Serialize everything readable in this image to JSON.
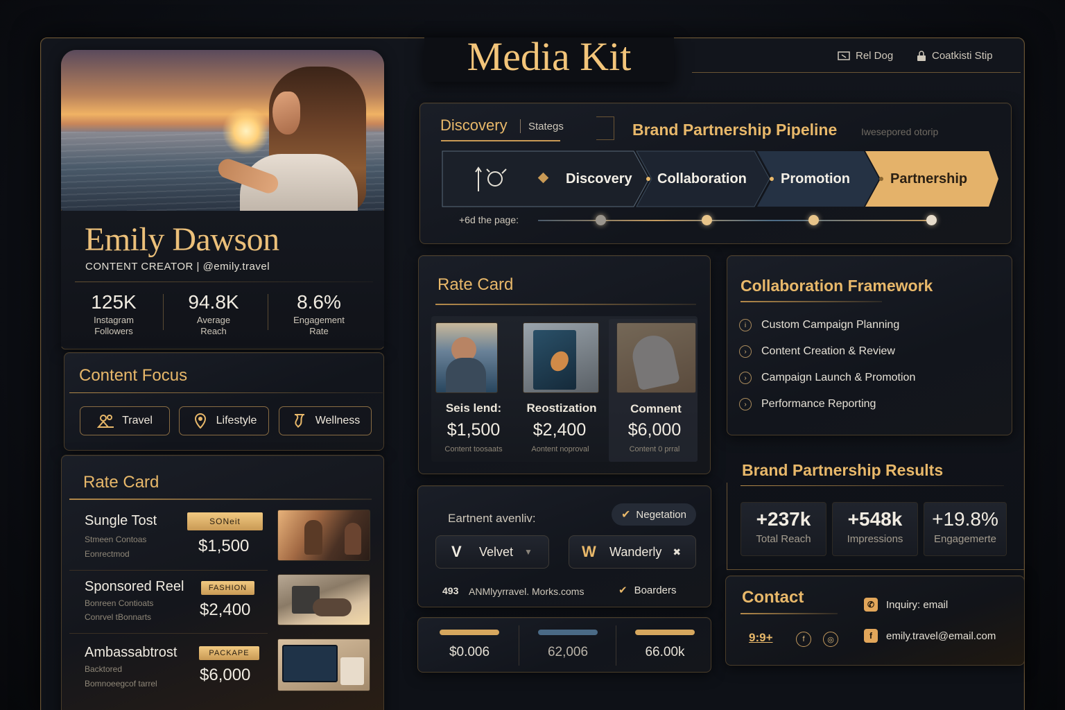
{
  "header": {
    "title": "Media Kit",
    "nav": [
      {
        "label": "Rel Dog",
        "icon": "display-icon"
      },
      {
        "label": "Coatkisti Stip",
        "icon": "lock-icon"
      }
    ]
  },
  "profile": {
    "name": "Emily Dawson",
    "subtitle": "CONTENT CREATOR | @emily.travel",
    "stats": [
      {
        "value": "125K",
        "label1": "Instagram",
        "label2": "Followers"
      },
      {
        "value": "94.8K",
        "label1": "Average",
        "label2": "Reach"
      },
      {
        "value": "8.6%",
        "label1": "Engagement",
        "label2": "Rate"
      }
    ]
  },
  "content_focus": {
    "title": "Content Focus",
    "tags": [
      {
        "label": "Travel",
        "icon": "people-icon"
      },
      {
        "label": "Lifestyle",
        "icon": "location-pin-icon"
      },
      {
        "label": "Wellness",
        "icon": "wellness-icon"
      }
    ]
  },
  "left_rate_card": {
    "title": "Rate Card",
    "rows": [
      {
        "title": "Sungle Tost",
        "sub1": "Stmeen Contoas",
        "sub2": "Eonrectmod",
        "badge": "SONeit",
        "price": "$1,500"
      },
      {
        "title": "Sponsored Reel",
        "sub1": "Bonreen Contioats",
        "sub2": "Conrvel tBonnarts",
        "badge": "FASHION",
        "price": "$2,400"
      },
      {
        "title": "Ambassabtrost",
        "sub1": "Backtored",
        "sub2": "Bomnoeegcof tarrel",
        "badge": "PACKAPE",
        "price": "$6,000"
      }
    ]
  },
  "pipeline": {
    "tab_active": "Discovery",
    "tab_inactive": "Stategs",
    "title": "Brand Partnership Pipeline",
    "subtitle": "Iwesepored otorip",
    "stages": [
      "Discovery",
      "Collaboration",
      "Promotion",
      "Partnership"
    ],
    "progress_label": "+6d the page:"
  },
  "mid_rate_card": {
    "title": "Rate Card",
    "items": [
      {
        "title": "Seis lend:",
        "price": "$1,500",
        "sub": "Content toosaats"
      },
      {
        "title": "Reostization",
        "price": "$2,400",
        "sub": "Aontent noproval"
      },
      {
        "title": "Comnent",
        "price": "$6,000",
        "sub": "Content 0 prral"
      }
    ]
  },
  "brand_panel": {
    "label": "Eartnent avenliv:",
    "badge": "Negetation",
    "brands": [
      {
        "letter": "V",
        "name": "Velvet"
      },
      {
        "letter": "W",
        "name": "Wanderly"
      }
    ],
    "link_number": "493",
    "link_text": "ANMlyyrravel. Morks.coms",
    "check_label": "Boarders"
  },
  "bars": {
    "items": [
      {
        "value": "$0.006",
        "color": "#d6a75e"
      },
      {
        "value": "62,006",
        "color": "#4a6a86"
      },
      {
        "value": "66.00k",
        "color": "#d6a75e"
      }
    ]
  },
  "framework": {
    "title": "Collaboration Framework",
    "items": [
      "Custom Campaign Planning",
      "Content Creation & Review",
      "Campaign Launch & Promotion",
      "Performance Reporting"
    ]
  },
  "results": {
    "title": "Brand Partnership Results",
    "items": [
      {
        "value": "+237k",
        "label": "Total Reach"
      },
      {
        "value": "+548k",
        "label": "Impressions"
      },
      {
        "value": "+19.8%",
        "label": "Engagemerte"
      }
    ]
  },
  "contact": {
    "title": "Contact",
    "handle_short": "9:9+",
    "inquiry": "Inquiry: email",
    "email": "emily.travel@email.com"
  }
}
